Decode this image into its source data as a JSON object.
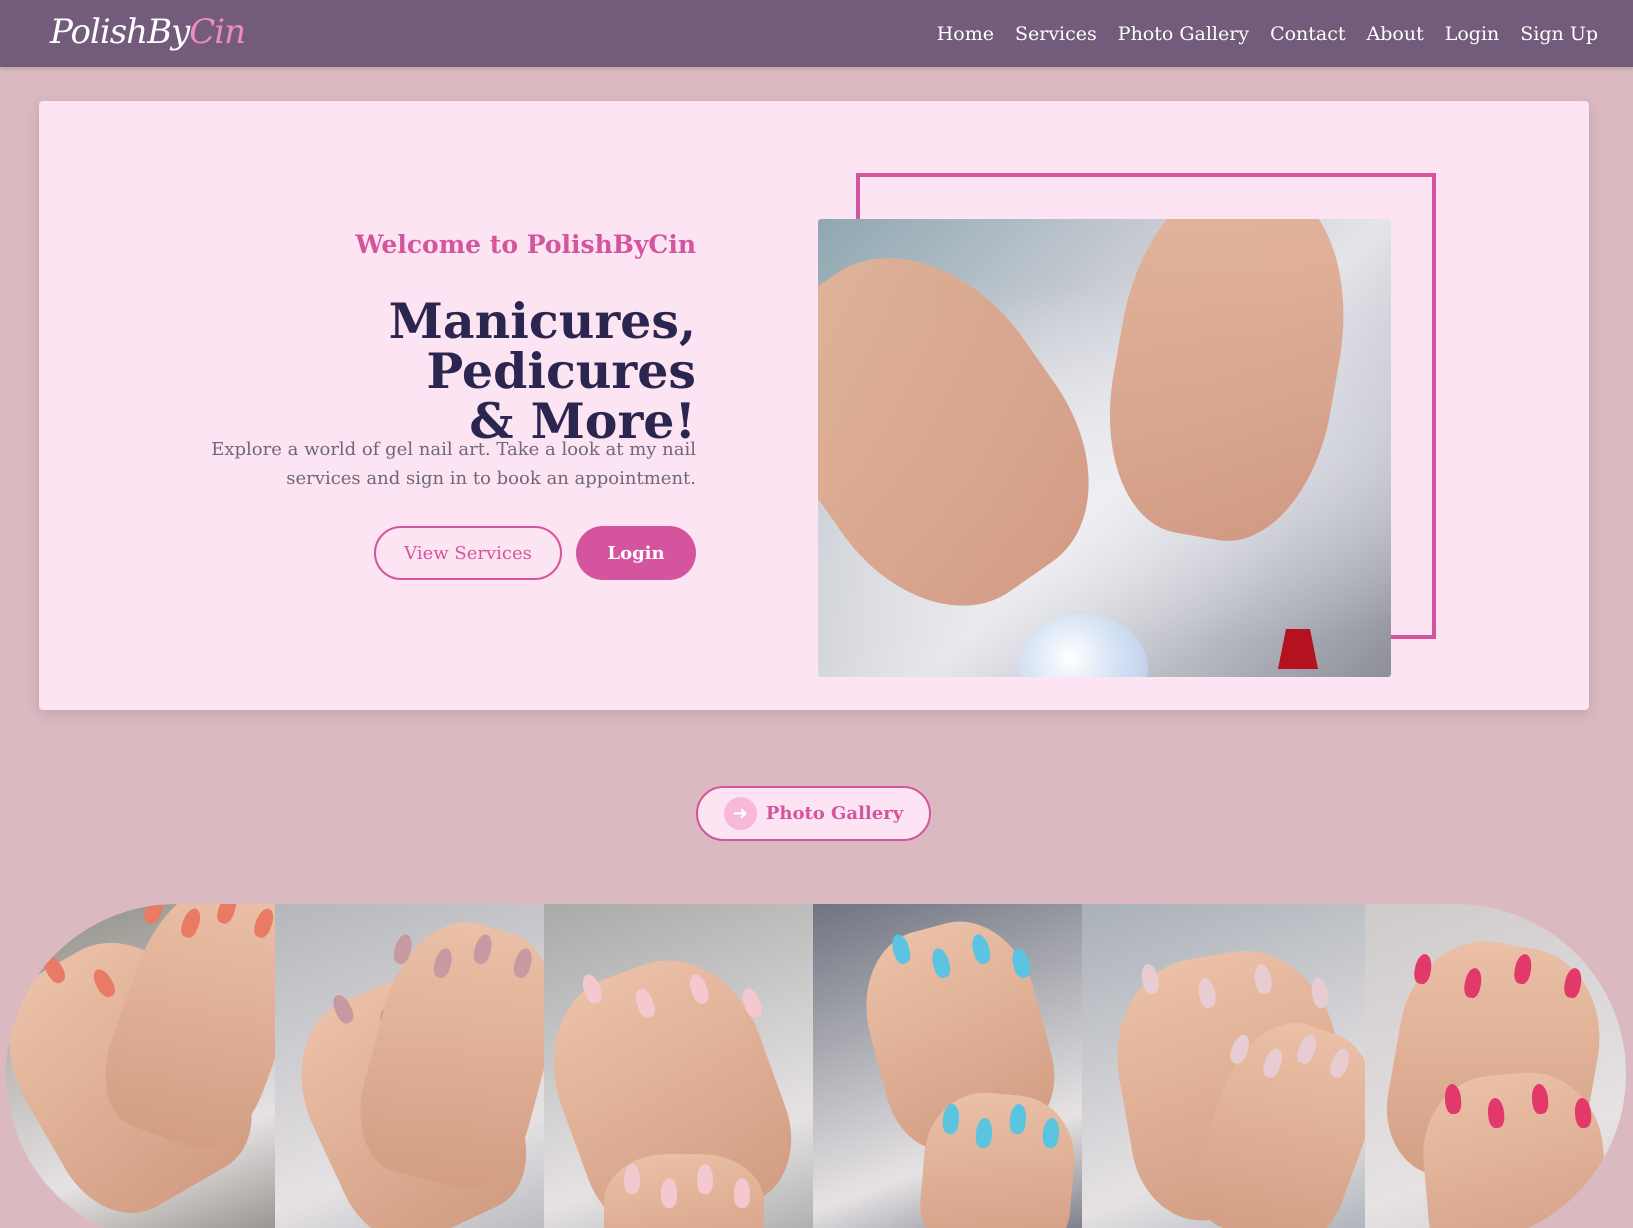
{
  "nav": {
    "brand_main": "PolishBy",
    "brand_accent": "Cin",
    "links": [
      "Home",
      "Services",
      "Photo Gallery",
      "Contact",
      "About",
      "Login",
      "Sign Up"
    ]
  },
  "hero": {
    "welcome": "Welcome to PolishByCin",
    "headline_line1": "Manicures, Pedicures",
    "headline_line2": "& More!",
    "description": "Explore a world of gel nail art. Take a look at my nail services and sign in to book an appointment.",
    "view_services_label": "View Services",
    "login_label": "Login"
  },
  "gallery": {
    "button_label": "Photo Gallery",
    "tiles": [
      {
        "name": "tile-1",
        "bg": "#8f8d86",
        "nails": "#e97a63"
      },
      {
        "name": "tile-2",
        "bg": "#b5b7bd",
        "nails": "#c69aa0"
      },
      {
        "name": "tile-3",
        "bg": "#a8aaa8",
        "nails": "#f3c8cf"
      },
      {
        "name": "tile-4",
        "bg": "#6f7480",
        "nails": "#5bc4e0"
      },
      {
        "name": "tile-5",
        "bg": "#a9b0b7",
        "nails": "#e7cdd2"
      },
      {
        "name": "tile-6",
        "bg": "#cfcaca",
        "nails": "#e2386a"
      }
    ]
  },
  "colors": {
    "page_bg": "#dbb9c0",
    "navbar": "#735c7b",
    "card_bg": "#fce4f2",
    "accent_pink": "#d4559e",
    "heading_navy": "#2b2650"
  }
}
